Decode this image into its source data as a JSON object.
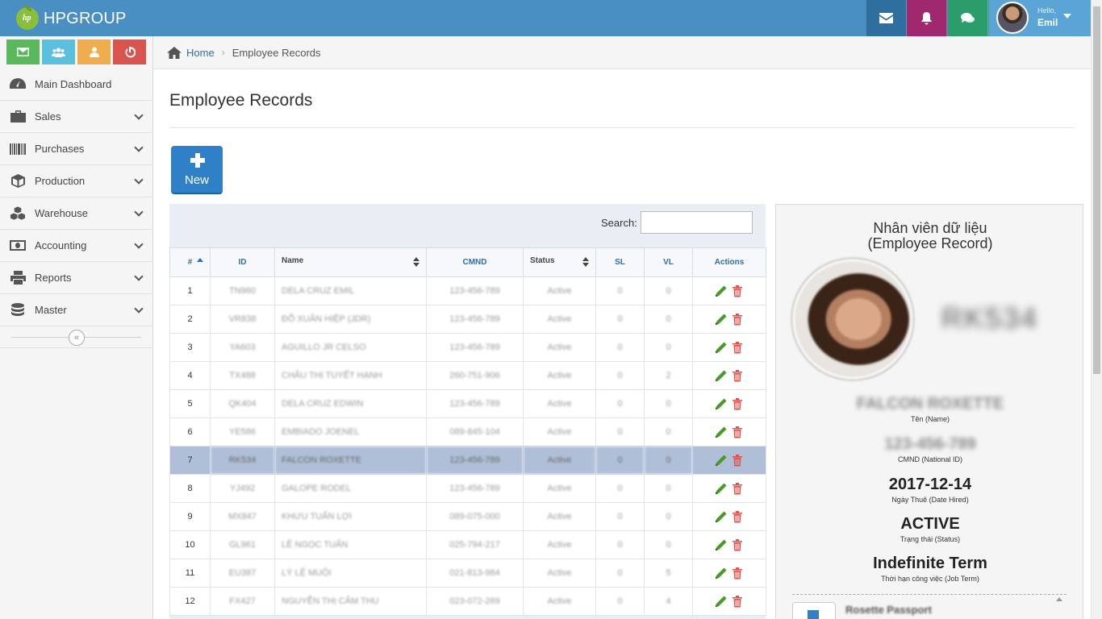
{
  "brand": {
    "name": "HPGROUP",
    "logo_text": "hp"
  },
  "colors": {
    "navbar": "#4a8fc2",
    "mail": "#2f6f9f",
    "bell": "#a0286f",
    "chat": "#2a9d6a",
    "user": "#5aa4d6",
    "primary": "#2f80c6",
    "selected_row": "#b0bfd8"
  },
  "navbar": {
    "icons": [
      "envelope-icon",
      "bell-icon",
      "chat-icon"
    ],
    "user": {
      "hello": "Hello,",
      "name": "Emil"
    }
  },
  "sidebar": {
    "shortcuts": [
      {
        "icon": "envelope-icon",
        "color": "#5cb85c"
      },
      {
        "icon": "users-icon",
        "color": "#5bc0de"
      },
      {
        "icon": "user-icon",
        "color": "#f0ad4e"
      },
      {
        "icon": "power-icon",
        "color": "#d9534f"
      }
    ],
    "items": [
      {
        "label": "Main Dashboard",
        "icon": "dashboard-icon",
        "has_children": false
      },
      {
        "label": "Sales",
        "icon": "briefcase-icon",
        "has_children": true
      },
      {
        "label": "Purchases",
        "icon": "barcode-icon",
        "has_children": true
      },
      {
        "label": "Production",
        "icon": "cube-icon",
        "has_children": true
      },
      {
        "label": "Warehouse",
        "icon": "cubes-icon",
        "has_children": true
      },
      {
        "label": "Accounting",
        "icon": "money-icon",
        "has_children": true
      },
      {
        "label": "Reports",
        "icon": "print-icon",
        "has_children": true
      },
      {
        "label": "Master",
        "icon": "database-icon",
        "has_children": true
      }
    ],
    "collapse_glyph": "«"
  },
  "breadcrumb": {
    "home": "Home",
    "separator": "›",
    "current": "Employee Records"
  },
  "page": {
    "title": "Employee Records",
    "new_button": "New"
  },
  "table": {
    "search_label": "Search:",
    "search_value": "",
    "columns": [
      "#",
      "ID",
      "Name",
      "CMND",
      "Status",
      "SL",
      "VL",
      "Actions"
    ],
    "rows": [
      {
        "n": "1",
        "id": "TN960",
        "name": "DELA CRUZ EMIL",
        "cmnd": "123-456-789",
        "status": "Active",
        "sl": "0",
        "vl": "0"
      },
      {
        "n": "2",
        "id": "VR838",
        "name": "ĐỖ XUÂN HIỆP (JDR)",
        "cmnd": "123-456-789",
        "status": "Active",
        "sl": "0",
        "vl": "0"
      },
      {
        "n": "3",
        "id": "YA603",
        "name": "AGUILLO JR CELSO",
        "cmnd": "123-456-789",
        "status": "Active",
        "sl": "0",
        "vl": "0"
      },
      {
        "n": "4",
        "id": "TX488",
        "name": "CHÂU THỊ TUYẾT HẠNH",
        "cmnd": "260-751-906",
        "status": "Active",
        "sl": "0",
        "vl": "2"
      },
      {
        "n": "5",
        "id": "QK404",
        "name": "DELA CRUZ EDWIN",
        "cmnd": "123-456-789",
        "status": "Active",
        "sl": "0",
        "vl": "0"
      },
      {
        "n": "6",
        "id": "YE586",
        "name": "EMBIADO JOENEL",
        "cmnd": "089-845-104",
        "status": "Active",
        "sl": "0",
        "vl": "0"
      },
      {
        "n": "7",
        "id": "RK534",
        "name": "FALCON ROXETTE",
        "cmnd": "123-456-789",
        "status": "Active",
        "sl": "0",
        "vl": "0",
        "selected": true
      },
      {
        "n": "8",
        "id": "YJ492",
        "name": "GALOPE RODEL",
        "cmnd": "123-456-789",
        "status": "Active",
        "sl": "0",
        "vl": "0"
      },
      {
        "n": "9",
        "id": "MX847",
        "name": "KHƯU TUẤN LỢI",
        "cmnd": "089-075-000",
        "status": "Active",
        "sl": "0",
        "vl": "0"
      },
      {
        "n": "10",
        "id": "GL961",
        "name": "LÊ NGỌC TUẤN",
        "cmnd": "025-794-217",
        "status": "Active",
        "sl": "0",
        "vl": "0"
      },
      {
        "n": "11",
        "id": "EU387",
        "name": "LÝ LỆ MUỘI",
        "cmnd": "021-813-984",
        "status": "Active",
        "sl": "0",
        "vl": "5"
      },
      {
        "n": "12",
        "id": "FX427",
        "name": "NGUYỄN THỊ CẨM THU",
        "cmnd": "023-072-269",
        "status": "Active",
        "sl": "0",
        "vl": "4"
      }
    ]
  },
  "detail": {
    "title_vi": "Nhân viên dữ liệu",
    "title_en": "(Employee Record)",
    "code": "RK534",
    "name": "FALCON ROXETTE",
    "name_label": "Tên (Name)",
    "cmnd": "123-456-789",
    "cmnd_label": "CMND (National ID)",
    "date_hired": "2017-12-14",
    "date_hired_label": "Ngày Thuê (Date Hired)",
    "status": "ACTIVE",
    "status_label": "Trạng thái (Status)",
    "job_term": "Indefinite Term",
    "job_term_label": "Thời hạn công việc (Job Term)",
    "document": "Rosette Passport"
  }
}
